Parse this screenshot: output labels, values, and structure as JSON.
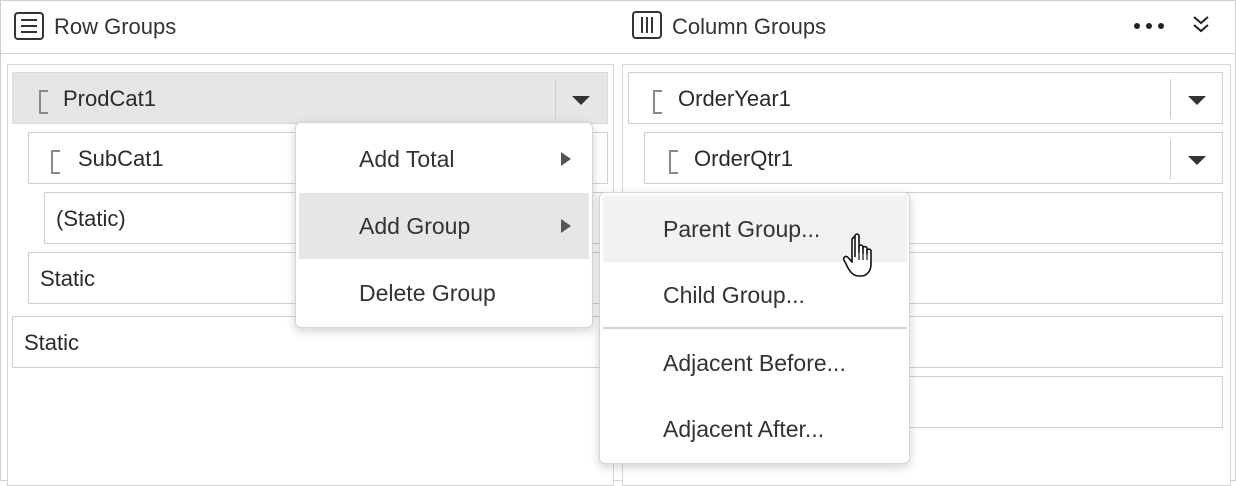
{
  "header": {
    "row_groups_title": "Row Groups",
    "column_groups_title": "Column Groups",
    "icons": {
      "row": "list-icon",
      "column": "columns-icon",
      "more": "more-horizontal-icon",
      "collapse": "double-chevron-down-icon"
    }
  },
  "row_groups": {
    "items": [
      {
        "label": "ProdCat1",
        "selected": true
      },
      {
        "label": "SubCat1"
      },
      {
        "label": "(Static)"
      },
      {
        "label": "Static"
      },
      {
        "label": "Static"
      }
    ]
  },
  "column_groups": {
    "items": [
      {
        "label": "OrderYear1"
      },
      {
        "label": "OrderQtr1"
      }
    ]
  },
  "context_menu": {
    "items": [
      {
        "label": "Add Total",
        "has_submenu": true
      },
      {
        "label": "Add Group",
        "has_submenu": true,
        "highlighted": true
      },
      {
        "label": "Delete Group"
      }
    ]
  },
  "submenu": {
    "items": [
      {
        "label": "Parent Group...",
        "hovered": true
      },
      {
        "label": "Child Group..."
      },
      {
        "label": "Adjacent Before..."
      },
      {
        "label": "Adjacent After..."
      }
    ]
  },
  "colors": {
    "selected_bg": "#e6e6e6",
    "border": "#d0d0d0",
    "text": "#2a2a2a"
  }
}
